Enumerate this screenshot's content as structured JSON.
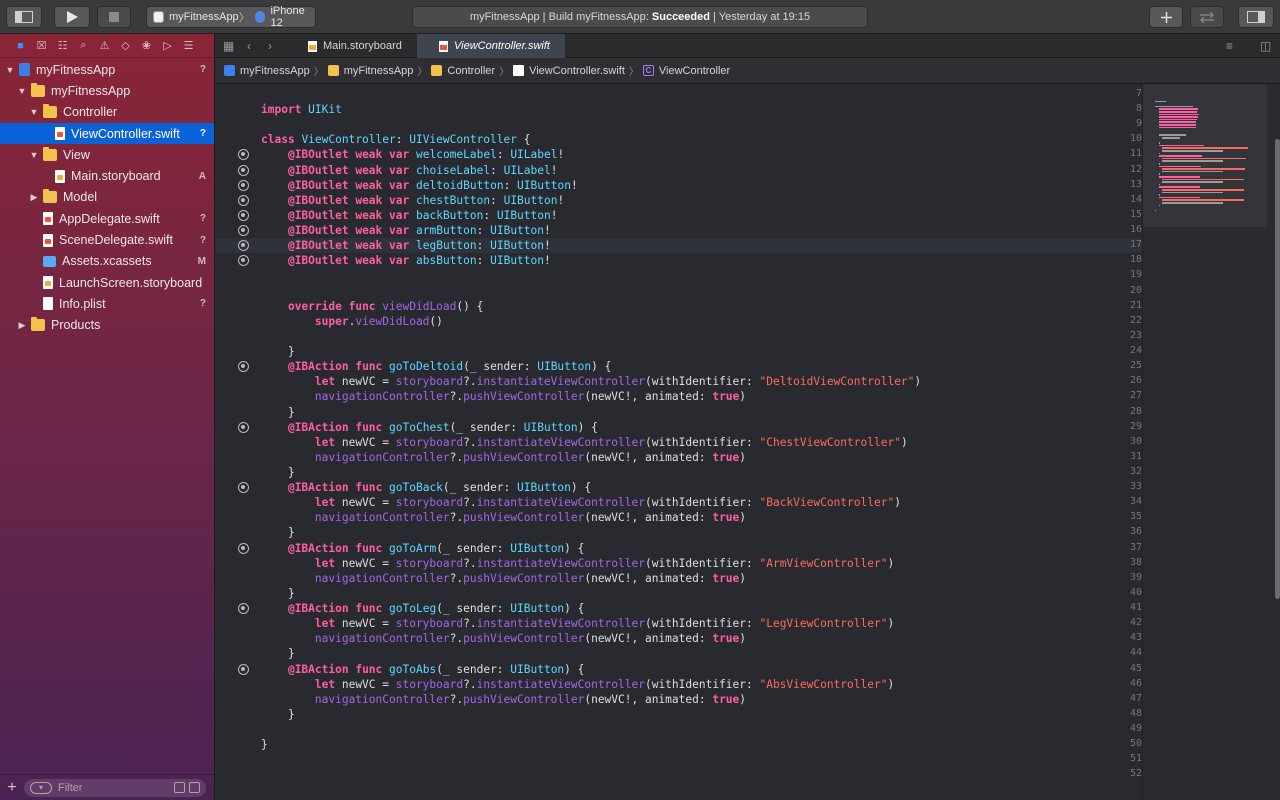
{
  "toolbar": {
    "scheme_app": "myFitnessApp",
    "scheme_device": "iPhone 12",
    "activity_prefix": "myFitnessApp | Build myFitnessApp: ",
    "activity_status": "Succeeded",
    "activity_time": " | Yesterday at 19:15"
  },
  "navigator": {
    "items": [
      {
        "label": "myFitnessApp",
        "badge": "?"
      },
      {
        "label": "myFitnessApp",
        "badge": ""
      },
      {
        "label": "Controller",
        "badge": ""
      },
      {
        "label": "ViewController.swift",
        "badge": "?"
      },
      {
        "label": "View",
        "badge": ""
      },
      {
        "label": "Main.storyboard",
        "badge": "A"
      },
      {
        "label": "Model",
        "badge": ""
      },
      {
        "label": "AppDelegate.swift",
        "badge": "?"
      },
      {
        "label": "SceneDelegate.swift",
        "badge": "?"
      },
      {
        "label": "Assets.xcassets",
        "badge": "M"
      },
      {
        "label": "LaunchScreen.storyboard",
        "badge": ""
      },
      {
        "label": "Info.plist",
        "badge": "?"
      },
      {
        "label": "Products",
        "badge": ""
      }
    ],
    "filter_placeholder": "Filter"
  },
  "tabs": [
    {
      "label": "Main.storyboard"
    },
    {
      "label": "ViewController.swift"
    }
  ],
  "jumpbar": [
    "myFitnessApp",
    "myFitnessApp",
    "Controller",
    "ViewController.swift",
    "ViewController"
  ],
  "code": {
    "line_numbers": [
      "7",
      "8",
      "9",
      "10",
      "11",
      "12",
      "13",
      "14",
      "15",
      "16",
      "17",
      "18",
      "19",
      "20",
      "21",
      "22",
      "23",
      "24",
      "25",
      "26",
      "27",
      "28",
      "29",
      "30",
      "31",
      "32",
      "33",
      "34",
      "35",
      "36",
      "37",
      "38",
      "39",
      "40",
      "41",
      "42",
      "43",
      "44",
      "45",
      "46",
      "47",
      "48",
      "49",
      "50",
      "51",
      "52"
    ],
    "lines": [
      "",
      "import UIKit",
      "",
      "class ViewController: UIViewController {",
      "    @IBOutlet weak var welcomeLabel: UILabel!",
      "    @IBOutlet weak var choiseLabel: UILabel!",
      "    @IBOutlet weak var deltoidButton: UIButton!",
      "    @IBOutlet weak var chestButton: UIButton!",
      "    @IBOutlet weak var backButton: UIButton!",
      "    @IBOutlet weak var armButton: UIButton!",
      "    @IBOutlet weak var legButton: UIButton!",
      "    @IBOutlet weak var absButton: UIButton!",
      "",
      "",
      "    override func viewDidLoad() {",
      "        super.viewDidLoad()",
      "",
      "    }",
      "    @IBAction func goToDeltoid(_ sender: UIButton) {",
      "        let newVC = storyboard?.instantiateViewController(withIdentifier: \"DeltoidViewController\")",
      "        navigationController?.pushViewController(newVC!, animated: true)",
      "    }",
      "    @IBAction func goToChest(_ sender: UIButton) {",
      "        let newVC = storyboard?.instantiateViewController(withIdentifier: \"ChestViewController\")",
      "        navigationController?.pushViewController(newVC!, animated: true)",
      "    }",
      "    @IBAction func goToBack(_ sender: UIButton) {",
      "        let newVC = storyboard?.instantiateViewController(withIdentifier: \"BackViewController\")",
      "        navigationController?.pushViewController(newVC!, animated: true)",
      "    }",
      "    @IBAction func goToArm(_ sender: UIButton) {",
      "        let newVC = storyboard?.instantiateViewController(withIdentifier: \"ArmViewController\")",
      "        navigationController?.pushViewController(newVC!, animated: true)",
      "    }",
      "    @IBAction func goToLeg(_ sender: UIButton) {",
      "        let newVC = storyboard?.instantiateViewController(withIdentifier: \"LegViewController\")",
      "        navigationController?.pushViewController(newVC!, animated: true)",
      "    }",
      "    @IBAction func goToAbs(_ sender: UIButton) {",
      "        let newVC = storyboard?.instantiateViewController(withIdentifier: \"AbsViewController\")",
      "        navigationController?.pushViewController(newVC!, animated: true)",
      "    }",
      "",
      "}",
      "",
      ""
    ],
    "breakpoint_lines": [
      11,
      12,
      13,
      14,
      15,
      16,
      17,
      18,
      25,
      29,
      33,
      37,
      41,
      45
    ],
    "highlighted_line": 17
  },
  "colors": {
    "keyword": "#fc5fa3",
    "type": "#5dd8ff",
    "project_type": "#d0a8ff",
    "method": "#a167e6",
    "string": "#fc6a5d",
    "selection": "#0a62d8"
  }
}
